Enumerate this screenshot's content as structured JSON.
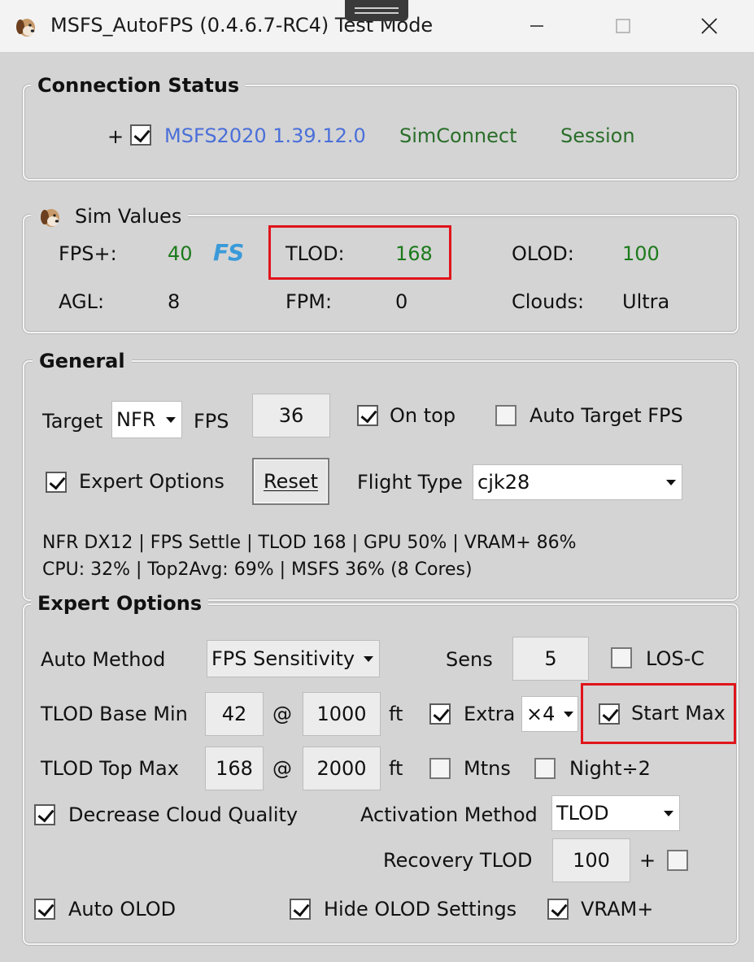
{
  "window": {
    "title": "MSFS_AutoFPS (0.4.6.7-RC4) Test Mode",
    "app_icon": "dog-icon"
  },
  "connection": {
    "title": "Connection Status",
    "prefix": "+",
    "sim_label": "MSFS2020 1.39.12.0",
    "simconnect": "SimConnect",
    "session": "Session",
    "sim_checked": true
  },
  "sim_values": {
    "title": "Sim Values",
    "fps_label": "FPS+:",
    "fps_value": "40",
    "fs_badge": "FS",
    "tlod_label": "TLOD:",
    "tlod_value": "168",
    "olod_label": "OLOD:",
    "olod_value": "100",
    "agl_label": "AGL:",
    "agl_value": "8",
    "fpm_label": "FPM:",
    "fpm_value": "0",
    "clouds_label": "Clouds:",
    "clouds_value": "Ultra"
  },
  "general": {
    "title": "General",
    "target_label": "Target",
    "target_mode": "NFR",
    "fps_label": "FPS",
    "fps_value": "36",
    "on_top_label": "On top",
    "auto_target_label": "Auto Target FPS",
    "expert_options_label": "Expert Options",
    "reset_label": "Reset",
    "flight_type_label": "Flight Type",
    "flight_type_value": "cjk28",
    "status_line1": "NFR DX12 | FPS Settle | TLOD 168 | GPU 50% | VRAM+ 86%",
    "status_line2": "CPU: 32% | Top2Avg: 69% | MSFS 36% (8 Cores)"
  },
  "expert": {
    "title": "Expert Options",
    "auto_method_label": "Auto Method",
    "auto_method_value": "FPS Sensitivity",
    "sens_label": "Sens",
    "sens_value": "5",
    "los_label": "LOS-C",
    "tlod_base_label": "TLOD Base Min",
    "tlod_base_value": "42",
    "at1": "@",
    "base_alt": "1000",
    "ft1": "ft",
    "extra_label": "Extra",
    "extra_value": "×4",
    "start_max_label": "Start Max",
    "tlod_top_label": "TLOD Top Max",
    "tlod_top_value": "168",
    "at2": "@",
    "top_alt": "2000",
    "ft2": "ft",
    "mtns_label": "Mtns",
    "night_label": "Night÷2",
    "decrease_cloud_label": "Decrease Cloud Quality",
    "activation_label": "Activation Method",
    "activation_value": "TLOD",
    "recovery_label": "Recovery TLOD",
    "recovery_value": "100",
    "recovery_plus": "+",
    "auto_olod_label": "Auto OLOD",
    "hide_olod_label": "Hide OLOD Settings",
    "vram_label": "VRAM+"
  },
  "highlight_color": "#e0141b"
}
